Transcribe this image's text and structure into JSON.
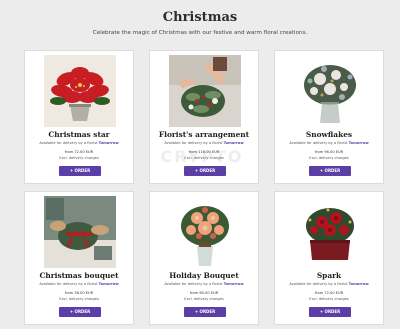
{
  "page": {
    "title": "Christmas",
    "subtitle": "Celebrate the magic of Christmas with our festive and warm floral creations."
  },
  "products": [
    {
      "name": "Christmas star",
      "availability_prefix": "Available for delivery by a florist",
      "availability_day": "Tomorrow",
      "price": "from 72.00 EUR",
      "charges": "Excl. delivery charges",
      "order_label": "+ ORDER",
      "photo": "red-poinsettia"
    },
    {
      "name": "Florist's arrangement",
      "availability_prefix": "Available for delivery by a florist",
      "availability_day": "Tomorrow",
      "price": "from 116.00 EUR",
      "charges": "Excl. delivery charges",
      "order_label": "+ ORDER",
      "photo": "hands-arranging-winter-bouquet"
    },
    {
      "name": "Snowflakes",
      "availability_prefix": "Available for delivery by a florist",
      "availability_day": "Tomorrow",
      "price": "from 96.00 EUR",
      "charges": "Excl. delivery charges",
      "order_label": "+ ORDER",
      "photo": "white-winter-bouquet-in-vase"
    },
    {
      "name": "Christmas bouquet",
      "availability_prefix": "Available for delivery by a florist",
      "availability_day": "Tomorrow",
      "price": "from 58.00 EUR",
      "charges": "Excl. delivery charges",
      "order_label": "+ ORDER",
      "photo": "hands-tying-red-ribbon"
    },
    {
      "name": "Holiday Bouquet",
      "availability_prefix": "Available for delivery by a florist",
      "availability_day": "Tomorrow",
      "price": "from 60.00 EUR",
      "charges": "Excl. delivery charges",
      "order_label": "+ ORDER",
      "photo": "peach-flower-bouquet-in-glass-vase"
    },
    {
      "name": "Spark",
      "availability_prefix": "Available for delivery by a florist",
      "availability_day": "Tomorrow",
      "price": "from 72.00 EUR",
      "charges": "Excl. delivery charges",
      "order_label": "+ ORDER",
      "photo": "red-roses-christmas-box"
    }
  ],
  "watermark": "CRYPTO",
  "colors": {
    "accent": "#5b3fa6",
    "background": "#ececec",
    "card": "#ffffff"
  }
}
